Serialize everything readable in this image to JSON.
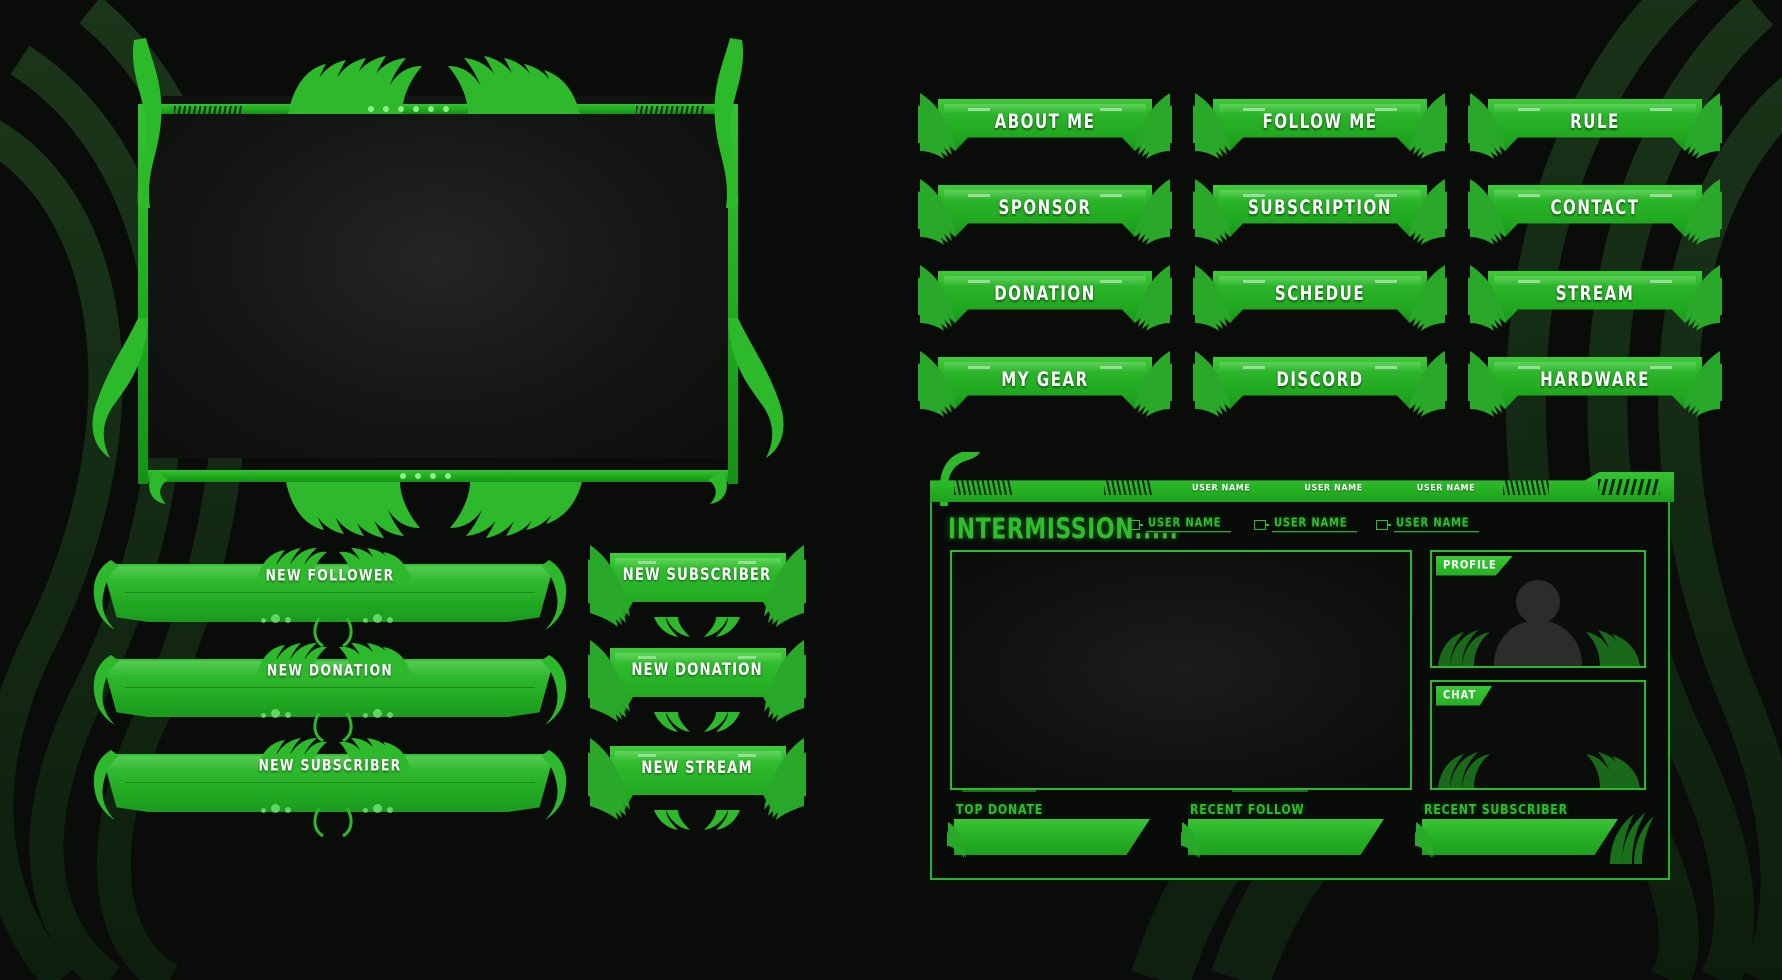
{
  "theme": {
    "background": "#090c09",
    "accent_green": "#2bb52a",
    "bright_green": "#3fcb38",
    "neon_green": "#2fbd2c",
    "text_white": "#ffffff"
  },
  "webcam": {
    "label": "webcam-frame",
    "dot_count": 6
  },
  "nav": {
    "buttons": [
      {
        "label": "ABOUT ME"
      },
      {
        "label": "FOLLOW ME"
      },
      {
        "label": "RULE"
      },
      {
        "label": "SPONSOR"
      },
      {
        "label": "SUBSCRIPTION"
      },
      {
        "label": "CONTACT"
      },
      {
        "label": "DONATION"
      },
      {
        "label": "SCHEDUE"
      },
      {
        "label": "STREAM"
      },
      {
        "label": "MY GEAR"
      },
      {
        "label": "DISCORD"
      },
      {
        "label": "HARDWARE"
      }
    ]
  },
  "wide_alerts": [
    {
      "label": "NEW FOLLOWER"
    },
    {
      "label": "NEW DONATION"
    },
    {
      "label": "NEW SUBSCRIBER"
    }
  ],
  "small_alerts": [
    {
      "label": "NEW SUBSCRIBER"
    },
    {
      "label": "NEW DONATION"
    },
    {
      "label": "NEW STREAM"
    }
  ],
  "intermission": {
    "title": "INTERMISSION.....",
    "topbar_items": [
      {
        "type": "hatch"
      },
      {
        "type": "hatch"
      },
      {
        "type": "name",
        "label": "USER NAME"
      },
      {
        "type": "name",
        "label": "USER NAME"
      },
      {
        "type": "name",
        "label": "USER NAME"
      },
      {
        "type": "hatch"
      },
      {
        "type": "hatch"
      }
    ],
    "user_chips": [
      {
        "label": "USER NAME"
      },
      {
        "label": "USER NAME"
      },
      {
        "label": "USER NAME"
      }
    ],
    "profile_tab": "PROFILE",
    "chat_tab": "CHAT",
    "bottom_slots": [
      {
        "label": "TOP DONATE"
      },
      {
        "label": "RECENT FOLLOW"
      },
      {
        "label": "RECENT SUBSCRIBER"
      }
    ]
  }
}
